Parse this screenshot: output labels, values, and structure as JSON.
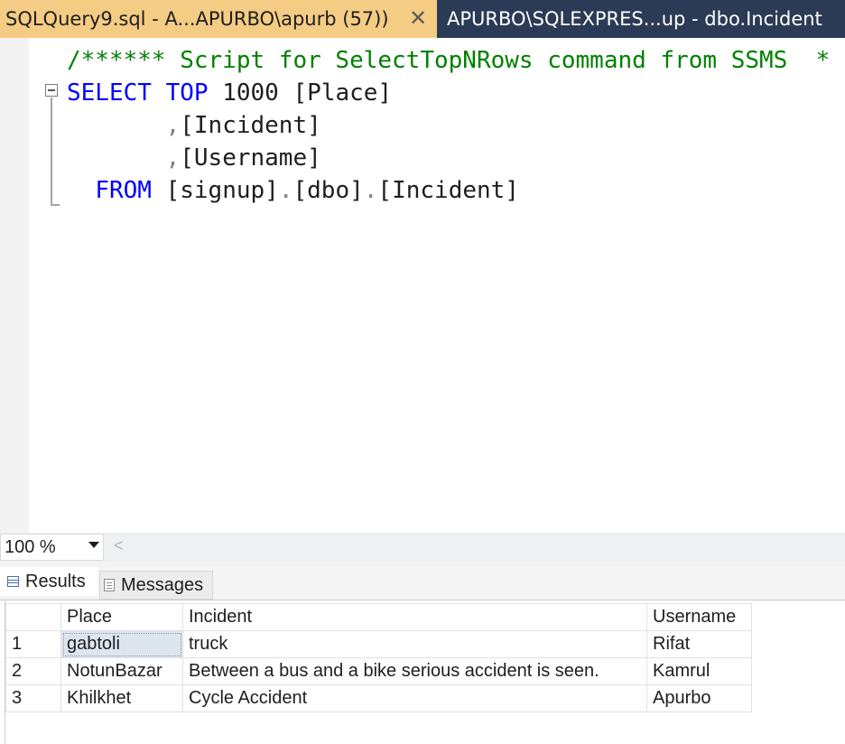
{
  "tabs": {
    "active_title": "SQLQuery9.sql - A...APURBO\\apurb (57))",
    "close_glyph": "✕",
    "inactive_title": "APURBO\\SQLEXPRES...up - dbo.Incident"
  },
  "editor": {
    "comment": "/****** Script for SelectTopNRows command from SSMS  *",
    "select_kw": "SELECT",
    "top_kw": "TOP",
    "top_value": "1000",
    "col1": "[Place]",
    "comma": ",",
    "col2": "[Incident]",
    "col3": "[Username]",
    "from_kw": "FROM",
    "db": "[signup]",
    "dot": ".",
    "schema": "[dbo]",
    "table": "[Incident]"
  },
  "zoom": {
    "value": "100 %",
    "scroll_left_glyph": "<"
  },
  "result_tabs": {
    "results_label": "Results",
    "messages_label": "Messages"
  },
  "results": {
    "columns": [
      "",
      "Place",
      "Incident",
      "Username"
    ],
    "rows": [
      [
        "1",
        "gabtoli",
        "truck",
        "Rifat"
      ],
      [
        "2",
        "NotunBazar",
        "Between a bus and a bike serious accident is seen.",
        "Kamrul"
      ],
      [
        "3",
        "Khilkhet",
        "Cycle Accident",
        "Apurbo"
      ]
    ]
  },
  "colors": {
    "tab_active": "#f5cc84",
    "tab_inactive": "#2b3a55",
    "keyword": "#0000ff",
    "comment": "#008000",
    "punctuation": "#808080"
  }
}
